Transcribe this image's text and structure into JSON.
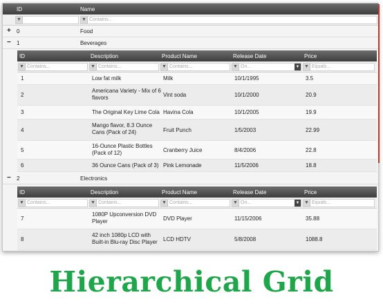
{
  "grid": {
    "columns": {
      "id": "ID",
      "name": "Name"
    },
    "filters": {
      "id": "",
      "name": "Contains..."
    },
    "parents": [
      {
        "expander": "+",
        "id": "0",
        "name": "Food"
      },
      {
        "expander": "−",
        "id": "1",
        "name": "Beverages"
      },
      {
        "expander": "−",
        "id": "2",
        "name": "Electronics"
      }
    ],
    "child_columns": {
      "id": "ID",
      "description": "Description",
      "product_name": "Product Name",
      "release_date": "Release Date",
      "price": "Price"
    },
    "child_filters": {
      "id": "Contains...",
      "description": "Contains...",
      "product_name": "Contains...",
      "release_date": "On...",
      "price": "Equals..."
    },
    "beverages": [
      {
        "id": "1",
        "description": "Low fat milk",
        "product_name": "Milk",
        "release_date": "10/1/1995",
        "price": "3.5"
      },
      {
        "id": "2",
        "description": "Americana Variety - Mix of 6 flavors",
        "product_name": "Vint soda",
        "release_date": "10/1/2000",
        "price": "20.9"
      },
      {
        "id": "3",
        "description": "The Original Key Lime Cola",
        "product_name": "Havina Cola",
        "release_date": "10/1/2005",
        "price": "19.9"
      },
      {
        "id": "4",
        "description": "Mango flavor, 8.3 Ounce Cans (Pack of 24)",
        "product_name": "Fruit Punch",
        "release_date": "1/5/2003",
        "price": "22.99"
      },
      {
        "id": "5",
        "description": "16-Ounce Plastic Bottles (Pack of 12)",
        "product_name": "Cranberry Juice",
        "release_date": "8/4/2006",
        "price": "22.8"
      },
      {
        "id": "6",
        "description": "36 Ounce Cans (Pack of 3)",
        "product_name": "Pink Lemonade",
        "release_date": "11/5/2006",
        "price": "18.8"
      }
    ],
    "electronics": [
      {
        "id": "7",
        "description": "1080P Upconversion DVD Player",
        "product_name": "DVD Player",
        "release_date": "11/15/2006",
        "price": "35.88"
      },
      {
        "id": "8",
        "description": "42 inch 1080p LCD with Built-in Blu-ray Disc Player",
        "product_name": "LCD HDTV",
        "release_date": "5/8/2008",
        "price": "1088.8"
      }
    ]
  },
  "icons": {
    "filter": "funnel-icon",
    "dropdown": "chevron-down-icon"
  },
  "colors": {
    "header": "#4a4a4a",
    "caption": "#1fa64a",
    "scroll_accent": "#c0392b"
  },
  "caption": "Hierarchical Grid"
}
